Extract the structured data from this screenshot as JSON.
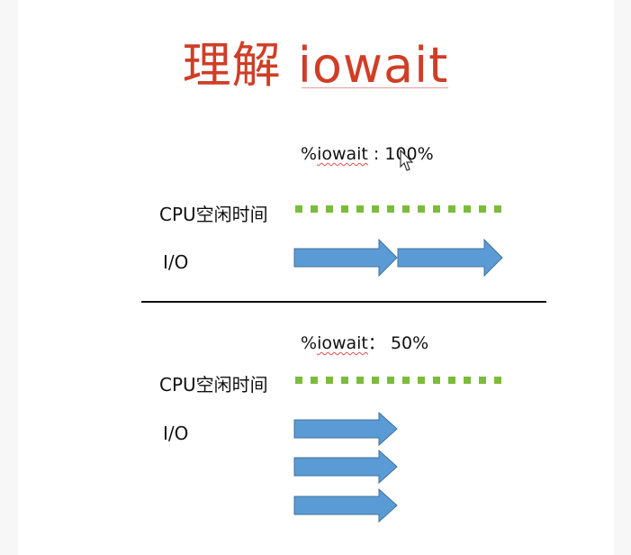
{
  "title": {
    "cn": "理解",
    "en": "iowait"
  },
  "top_panel": {
    "metric_prefix": "%",
    "metric_name": "iowait",
    "metric_sep": " : ",
    "metric_value": "100%",
    "cpu_label": "CPU空闲时间",
    "io_label": "I/O"
  },
  "bottom_panel": {
    "metric_prefix": "%",
    "metric_name": "iowait",
    "metric_sep": "： ",
    "metric_value": "50%",
    "cpu_label": "CPU空闲时间",
    "io_label": "I/O"
  },
  "colors": {
    "title": "#cf3e26",
    "idle_dots": "#7dbb3c",
    "io_arrow_fill": "#5b9bd5",
    "io_arrow_stroke": "#41719c",
    "divider": "#111111"
  },
  "icons": [
    "mouse-cursor-icon"
  ]
}
